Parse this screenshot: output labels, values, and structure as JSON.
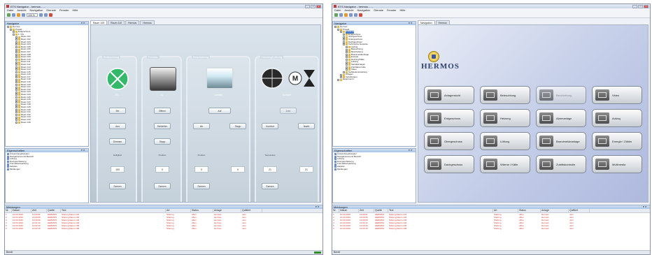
{
  "left_window": {
    "title": "ETS Navigator - hermos - ...",
    "menu": [
      "Datei",
      "Ansicht",
      "Navigation",
      "Dienste",
      "Fenster",
      "Hilfe"
    ],
    "zoom": "100 %",
    "navigator_title": "Navigator",
    "tree": [
      {
        "label": "Hermos",
        "level": 0
      },
      {
        "label": "Projekt",
        "level": 1
      },
      {
        "label": "Erdgeschoss",
        "level": 2
      },
      {
        "label": "1. OG",
        "level": 2
      },
      {
        "label": "Raum 101",
        "level": 3
      },
      {
        "label": "Raum 102",
        "level": 3
      },
      {
        "label": "Raum 103",
        "level": 3
      },
      {
        "label": "Raum 104",
        "level": 3
      },
      {
        "label": "Raum 105",
        "level": 3
      },
      {
        "label": "Raum 106",
        "level": 3
      },
      {
        "label": "Raum 107",
        "level": 3
      },
      {
        "label": "Raum 108",
        "level": 3
      },
      {
        "label": "Raum 109",
        "level": 3
      },
      {
        "label": "Raum 110",
        "level": 3
      },
      {
        "label": "Raum 111",
        "level": 3
      },
      {
        "label": "Raum 112",
        "level": 3
      },
      {
        "label": "Raum 113",
        "level": 3
      },
      {
        "label": "Raum 114",
        "level": 3
      },
      {
        "label": "Raum 115",
        "level": 3
      },
      {
        "label": "Raum 116",
        "level": 3
      },
      {
        "label": "Raum 117",
        "level": 3
      },
      {
        "label": "Raum 118",
        "level": 3
      },
      {
        "label": "Raum 119",
        "level": 3
      },
      {
        "label": "Raum 120",
        "level": 3
      },
      {
        "label": "Raum 121",
        "level": 3
      },
      {
        "label": "Raum 122",
        "level": 3
      },
      {
        "label": "Raum 123",
        "level": 3
      },
      {
        "label": "Raum 124",
        "level": 3
      },
      {
        "label": "Raum 125",
        "level": 3
      },
      {
        "label": "Raum 126",
        "level": 3
      },
      {
        "label": "Raum 127",
        "level": 3
      },
      {
        "label": "Raum 128",
        "level": 3
      },
      {
        "label": "Raum 129",
        "level": 3
      },
      {
        "label": "Raum 130",
        "level": 3
      },
      {
        "label": "Raum 131",
        "level": 3
      },
      {
        "label": "Raum 132",
        "level": 3
      },
      {
        "label": "Raum 133",
        "level": 3
      },
      {
        "label": "Raum 134",
        "level": 3
      },
      {
        "label": "Raum 135",
        "level": 3
      }
    ],
    "properties_title": "Eigenschaften",
    "properties": [
      "Anwendungsbeispiel",
      "Navigationsmenü Bereich",
      "Lüftung",
      "Energieerfassung",
      "Fremdüberwachung",
      "Zeitplan",
      "Meldungen"
    ],
    "tabs": [
      "Raum 109",
      "Raum 110",
      "Hermos",
      "Hermos"
    ],
    "groups": [
      {
        "title": "Beleuchtung",
        "vis_label": "Ein",
        "buttons": [
          "Ein",
          "Aus",
          "Dimmen"
        ],
        "text": "Helligkeit",
        "value": "100",
        "bottom": "Szenen"
      },
      {
        "title": "Fenster",
        "vis_label": "Zu",
        "buttons": [
          "Öffnen",
          "Schließen",
          "Stopp"
        ],
        "text": "Position",
        "value": "0",
        "bottom": "Szenen"
      },
      {
        "title": "Beschattung",
        "vis_label": "Lamelle",
        "buttons": [
          "Auf",
          "Ab",
          "Stopp"
        ],
        "text": "Position",
        "value": "0",
        "value2": "0",
        "bottom": "Szenen"
      },
      {
        "title": "Heizung/Lüftung",
        "vis_label": "Sollwert",
        "buttons": [
          "Auto",
          "Komfort",
          "Nacht"
        ],
        "text": "Temperatur",
        "value": "21",
        "value2": "21",
        "bottom": "Szenen"
      }
    ],
    "log_title": "Meldungen",
    "log_headers": [
      "Nr.",
      "Datum",
      "Zeit",
      "Quelle",
      "Text",
      "Art",
      "Status",
      "Anlage",
      "Quittiert"
    ],
    "log_rows": [
      [
        "1",
        "10.03.2010",
        "12:00:01",
        "HERMOS",
        "Störung Raum 101",
        "Störung",
        "offen",
        "Hermos",
        "nein"
      ],
      [
        "2",
        "10.03.2010",
        "12:00:05",
        "HERMOS",
        "Störung Raum 102",
        "Störung",
        "offen",
        "Hermos",
        "nein"
      ],
      [
        "3",
        "10.03.2010",
        "12:00:09",
        "HERMOS",
        "Störung Raum 103",
        "Störung",
        "offen",
        "Hermos",
        "nein"
      ],
      [
        "4",
        "10.03.2010",
        "12:01:12",
        "HERMOS",
        "Störung Raum 104",
        "Störung",
        "offen",
        "Hermos",
        "nein"
      ],
      [
        "5",
        "10.03.2010",
        "12:02:40",
        "HERMOS",
        "Störung Raum 105",
        "Störung",
        "offen",
        "Hermos",
        "nein"
      ],
      [
        "6",
        "10.03.2010",
        "12:03:15",
        "HERMOS",
        "Störung Raum 106",
        "Störung",
        "offen",
        "Hermos",
        "nein"
      ]
    ],
    "status": "Bereit"
  },
  "right_window": {
    "title": "ETS Navigator - hermos - ...",
    "menu": [
      "Datei",
      "Ansicht",
      "Navigation",
      "Dienste",
      "Fenster",
      "Hilfe"
    ],
    "navigator_title": "Navigator",
    "tree": [
      {
        "label": "Hermos",
        "level": 0
      },
      {
        "label": "Projekt",
        "level": 1
      },
      {
        "label": "Gebäude",
        "level": 2
      },
      {
        "label": "Erdgeschoss",
        "level": 3
      },
      {
        "label": "Obergeschoss",
        "level": 3
      },
      {
        "label": "Untergeschoss",
        "level": 3
      },
      {
        "label": "Dachgeschoss",
        "level": 3
      },
      {
        "label": "Technische Gewerke",
        "level": 3
      },
      {
        "label": "Aufzug",
        "level": 4
      },
      {
        "label": "Beleuchtung",
        "level": 4
      },
      {
        "label": "Beschattung",
        "level": 4
      },
      {
        "label": "Brandmeldeanlage",
        "level": 4
      },
      {
        "label": "Energie",
        "level": 4
      },
      {
        "label": "Heizung/Kälte",
        "level": 4
      },
      {
        "label": "Lüftung",
        "level": 4
      },
      {
        "label": "Sanitäranlagen",
        "level": 4
      },
      {
        "label": "Zutrittskontrolle",
        "level": 4
      },
      {
        "label": "Video",
        "level": 4
      },
      {
        "label": "Gebäudeverwaltung",
        "level": 3
      },
      {
        "label": "Anlagen",
        "level": 2
      },
      {
        "label": "Verteilungen",
        "level": 2
      },
      {
        "label": "Hauptmenü",
        "level": 1
      }
    ],
    "properties_title": "Eigenschaften",
    "properties": [
      "Anwendungsbeispiel",
      "Navigationsmenü Bereich",
      "Lüftung",
      "Energieerfassung",
      "Fremdüberwachung",
      "Zeitplan",
      "Meldungen"
    ],
    "tabs": [
      "Navigation",
      "Hermos"
    ],
    "logo": "HERMOS",
    "tiles": [
      [
        "Anlagensicht",
        "Beleuchtung",
        "Beschattung",
        "Video"
      ],
      [
        "Erdgeschoss",
        "Heizung",
        "Alarmanlage",
        "Aufzug"
      ],
      [
        "Obergeschoss",
        "Lüftung",
        "Brandmeldeanlage",
        "Energie / Zähler"
      ],
      [
        "Dachgeschoss",
        "Wärme / Kälte",
        "Zutrittskontrolle",
        "Multimedia"
      ]
    ],
    "log_title": "Meldungen",
    "log_headers": [
      "Nr.",
      "Datum",
      "Zeit",
      "Quelle",
      "Text",
      "Art",
      "Status",
      "Anlage",
      "Quittiert"
    ],
    "log_rows": [
      [
        "1",
        "10.03.2010",
        "12:00:01",
        "HERMOS",
        "Störung Raum 101",
        "Störung",
        "offen",
        "Hermos",
        "nein"
      ],
      [
        "2",
        "10.03.2010",
        "12:00:05",
        "HERMOS",
        "Störung Raum 102",
        "Störung",
        "offen",
        "Hermos",
        "nein"
      ],
      [
        "3",
        "10.03.2010",
        "12:00:09",
        "HERMOS",
        "Störung Raum 103",
        "Störung",
        "offen",
        "Hermos",
        "nein"
      ],
      [
        "4",
        "10.03.2010",
        "12:01:12",
        "HERMOS",
        "Störung Raum 104",
        "Störung",
        "offen",
        "Hermos",
        "nein"
      ],
      [
        "5",
        "10.03.2010",
        "12:02:40",
        "HERMOS",
        "Störung Raum 105",
        "Störung",
        "offen",
        "Hermos",
        "nein"
      ],
      [
        "6",
        "10.03.2010",
        "12:03:15",
        "HERMOS",
        "Störung Raum 106",
        "Störung",
        "offen",
        "Hermos",
        "nein"
      ]
    ],
    "status": "Bereit"
  }
}
